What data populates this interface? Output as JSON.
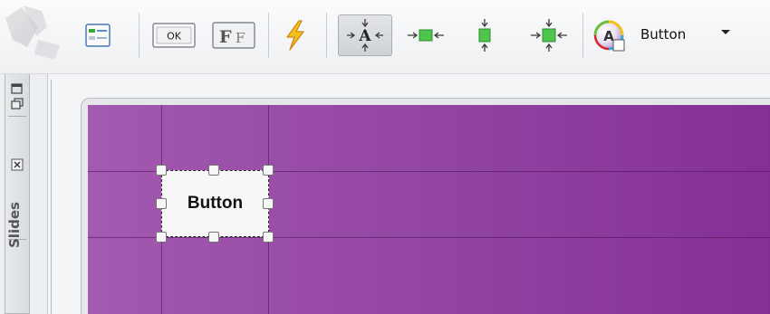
{
  "toolbar": {
    "buttons": [
      {
        "name": "layout-panel-button",
        "icon": "list-panel-icon"
      },
      {
        "name": "ok-button",
        "icon": "ok-button-icon",
        "label": "OK"
      },
      {
        "name": "font-style-button",
        "icon": "font-letters-icon",
        "label": "F F"
      },
      {
        "name": "events-button",
        "icon": "lightning-icon"
      },
      {
        "name": "align-center-both-button",
        "icon": "center-text-icon",
        "label": "A",
        "active": true
      },
      {
        "name": "align-horizontal-button",
        "icon": "center-horizontal-icon"
      },
      {
        "name": "align-vertical-button",
        "icon": "center-vertical-icon"
      },
      {
        "name": "align-center-button",
        "icon": "center-both-icon"
      }
    ],
    "style_combo": {
      "icon": "style-palette-icon",
      "icon_letter": "A",
      "label": "Button"
    }
  },
  "side_panel": {
    "tab_label": "Slides",
    "icons": [
      "restore-window-icon",
      "close-icon"
    ]
  },
  "slide": {
    "background_colors": [
      "#a35ab0",
      "#842f96"
    ],
    "widget": {
      "label": "Button",
      "selected": true
    }
  }
}
